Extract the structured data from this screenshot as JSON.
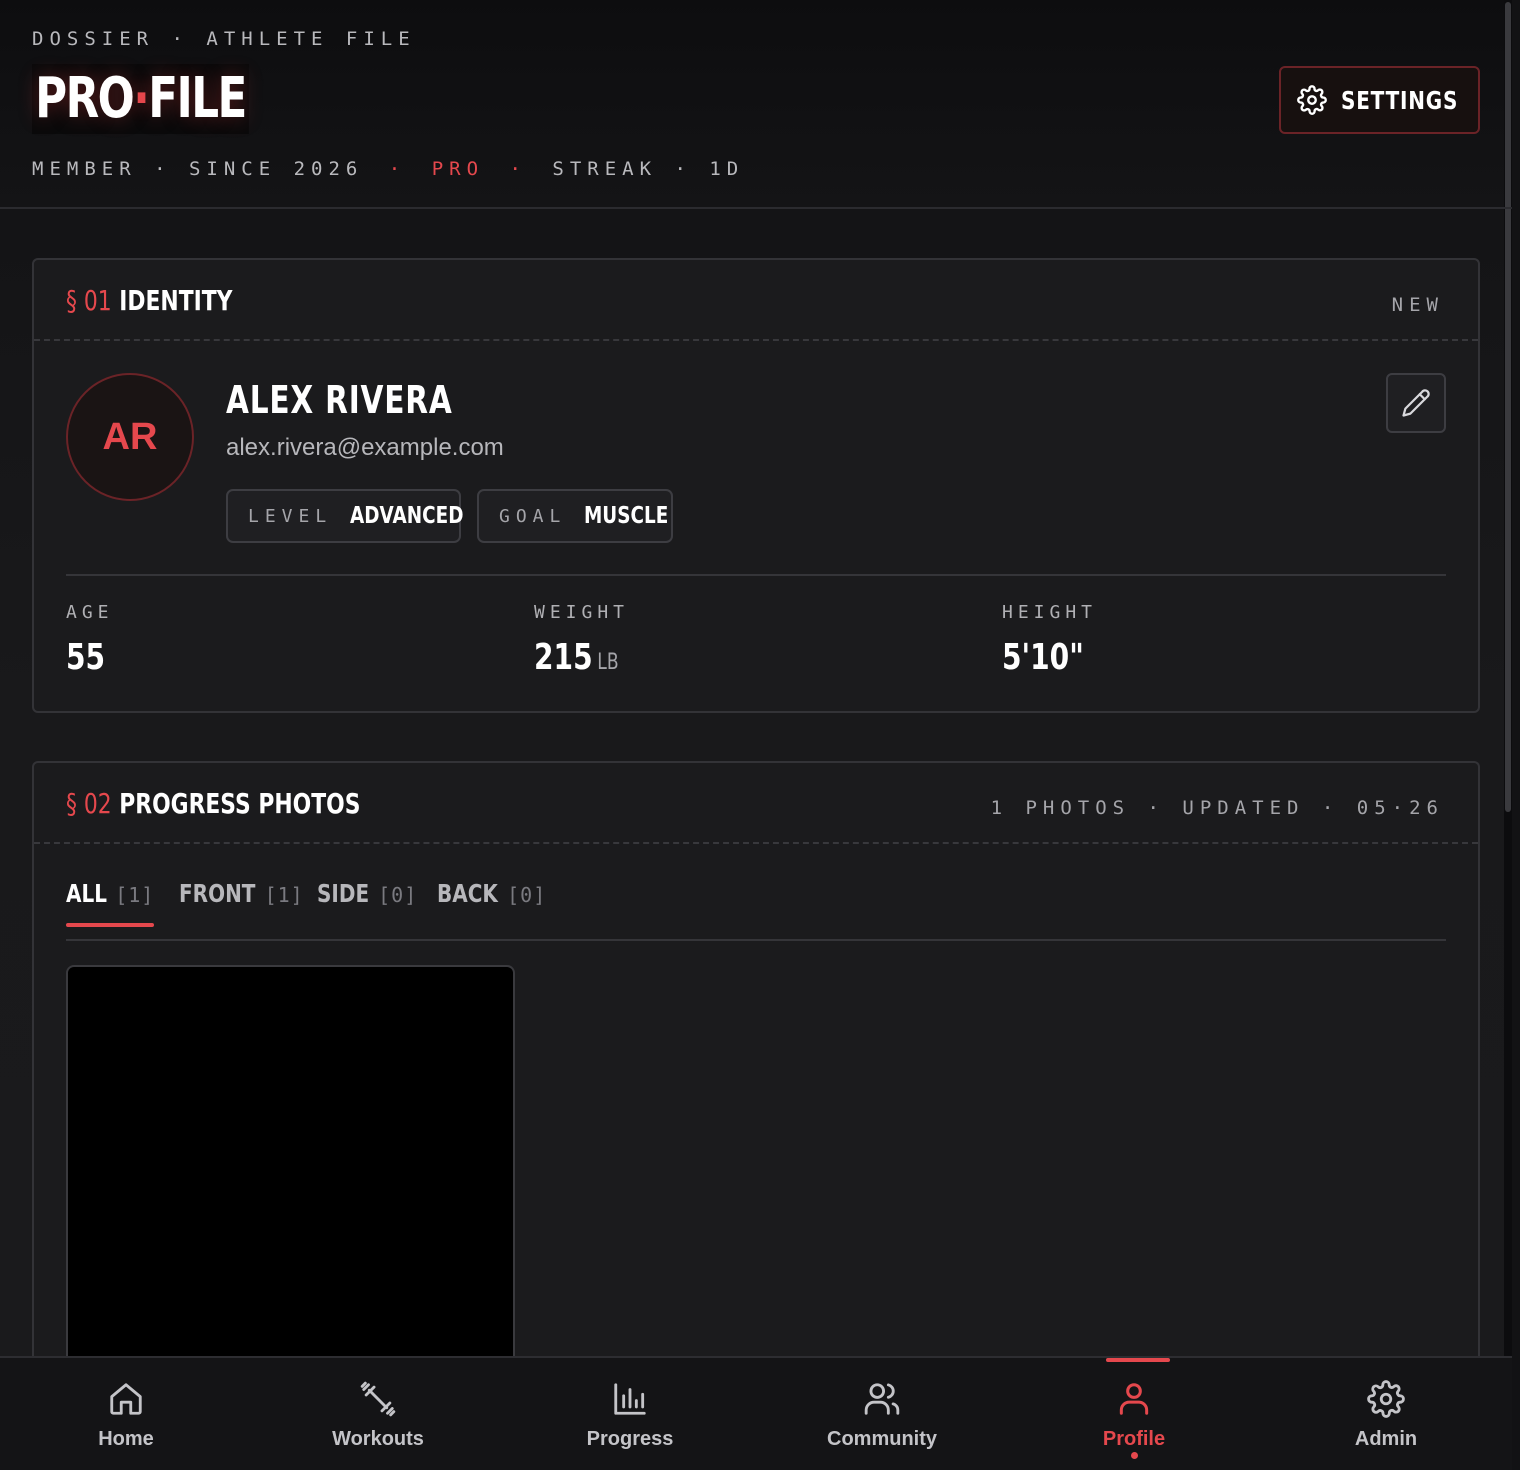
{
  "header": {
    "eyebrow": "DOSSIER · ATHLETE FILE",
    "title_a": "PRO",
    "title_dot": "·",
    "title_b": "FILE",
    "member": "MEMBER · SINCE 2026",
    "sep": "·",
    "tier": "PRO",
    "streak": "STREAK · 1D",
    "settings_label": "SETTINGS"
  },
  "identity": {
    "section_num": "§ 01",
    "section_title": "IDENTITY",
    "badge": "NEW",
    "initials": "AR",
    "name": "ALEX RIVERA",
    "email": "alex.rivera@example.com",
    "level_key": "LEVEL",
    "level_value": "ADVANCED",
    "goal_key": "GOAL",
    "goal_value": "MUSCLE",
    "stats": [
      {
        "label": "AGE",
        "value": "55",
        "unit": ""
      },
      {
        "label": "WEIGHT",
        "value": "215",
        "unit": "LB"
      },
      {
        "label": "HEIGHT",
        "value": "5'10\"",
        "unit": ""
      }
    ]
  },
  "photos": {
    "section_num": "§ 02",
    "section_title": "PROGRESS PHOTOS",
    "summary": "1 PHOTOS · UPDATED · 05·26",
    "tabs": [
      {
        "label": "ALL",
        "count": "[1]"
      },
      {
        "label": "FRONT",
        "count": "[1]"
      },
      {
        "label": "SIDE",
        "count": "[0]"
      },
      {
        "label": "BACK",
        "count": "[0]"
      }
    ],
    "active_tab": "ALL"
  },
  "nav": {
    "items": [
      {
        "label": "Home",
        "icon": "home-icon"
      },
      {
        "label": "Workouts",
        "icon": "dumbbell-icon"
      },
      {
        "label": "Progress",
        "icon": "bar-chart-icon"
      },
      {
        "label": "Community",
        "icon": "users-icon"
      },
      {
        "label": "Profile",
        "icon": "user-icon"
      },
      {
        "label": "Admin",
        "icon": "gear-icon"
      }
    ],
    "active": "Profile"
  },
  "colors": {
    "accent": "#e5484d",
    "background": "#141416",
    "card": "#1b1b1d"
  }
}
